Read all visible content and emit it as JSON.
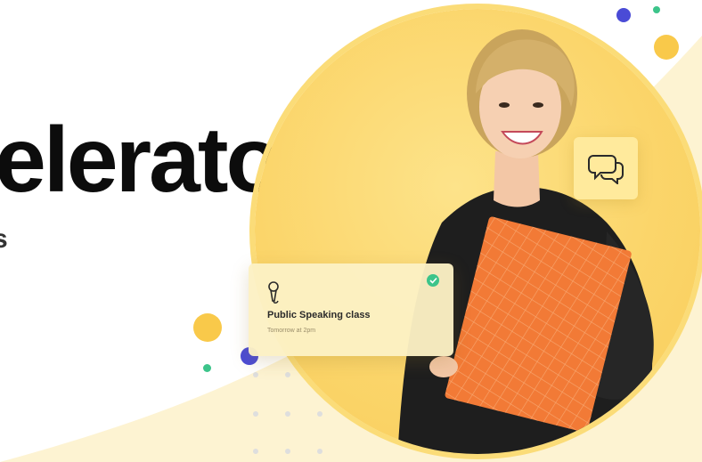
{
  "hero": {
    "title": "elerator",
    "subtitle": "s"
  },
  "event_card": {
    "title": "Public Speaking class",
    "time": "Tomorrow at 2pm",
    "icon": "microphone-icon",
    "status_icon": "check-circle-icon"
  },
  "chat_card": {
    "icon": "chat-bubbles-icon"
  },
  "colors": {
    "accent_yellow": "#fbd56a",
    "dot_blue": "#4a4bd6",
    "dot_green": "#3cc48a",
    "dot_yellow": "#f9c94a",
    "orange_folder": "#f27a36",
    "sweater": "#1f1f1f"
  }
}
